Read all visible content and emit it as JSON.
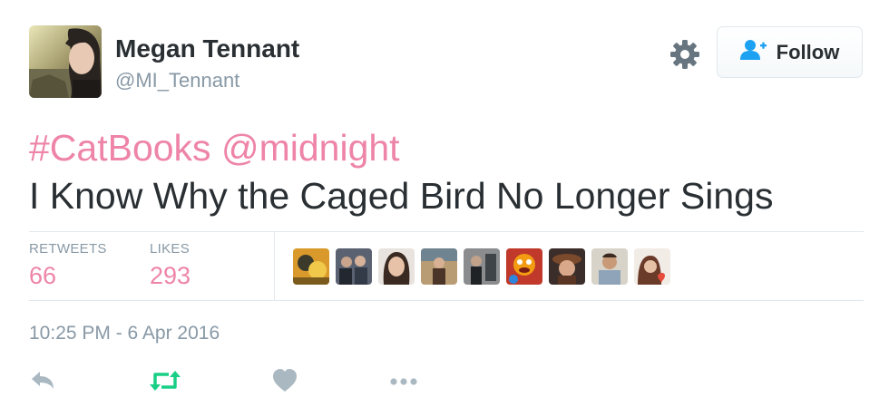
{
  "author": {
    "name": "Megan Tennant",
    "handle": "@MI_Tennant"
  },
  "follow_button": {
    "label": "Follow"
  },
  "tweet": {
    "hashtag": "#CatBooks",
    "mention": "@midnight",
    "text": "I Know Why the Caged Bird No Longer Sings"
  },
  "stats": {
    "retweets_label": "RETWEETS",
    "retweets_value": "66",
    "likes_label": "LIKES",
    "likes_value": "293"
  },
  "liker_avatar_count": 9,
  "timestamp": "10:25 PM - 6 Apr 2016",
  "icons": [
    "gear-icon",
    "follow-person-icon",
    "reply-icon",
    "retweet-icon",
    "like-heart-icon",
    "more-icon"
  ],
  "colors": {
    "accent_pink": "#ee84a8",
    "retweet_green": "#19cf86",
    "follow_blue": "#1da1f2",
    "muted_gray": "#8899a6",
    "text_dark": "#292f33"
  }
}
